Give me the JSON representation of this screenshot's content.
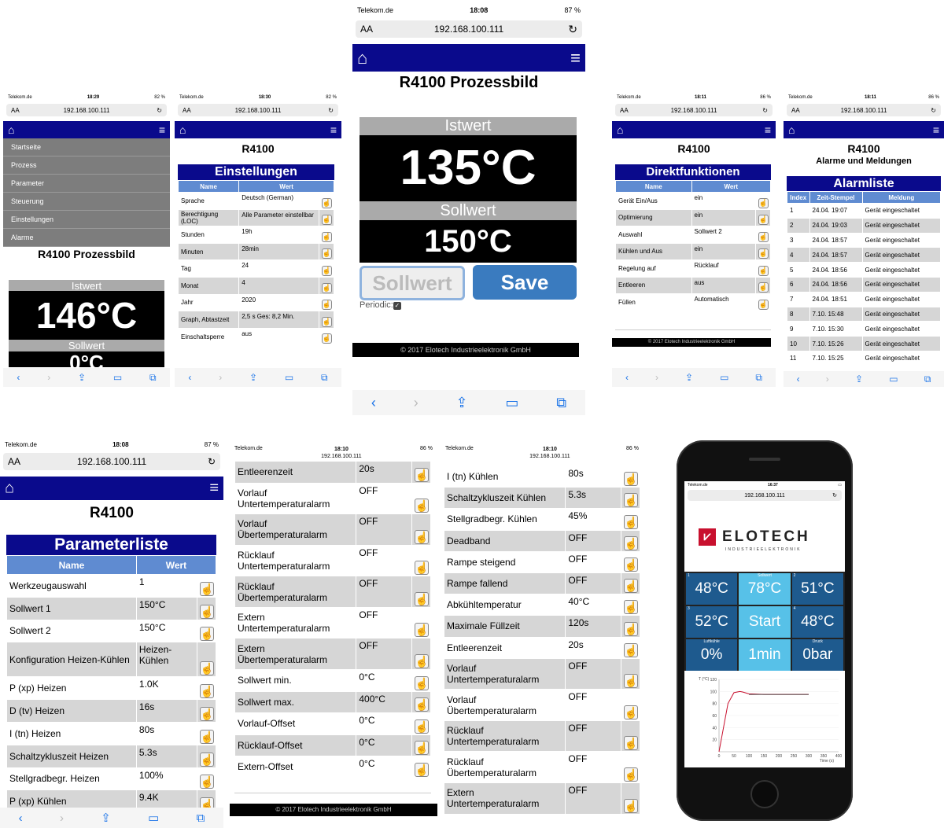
{
  "status": {
    "carrier": "Telekom.de",
    "url": "192.168.100.111",
    "aa": "AA"
  },
  "p1": {
    "time": "18:29",
    "batt": "82 %",
    "menu": [
      "Startseite",
      "Prozess",
      "Parameter",
      "Steuerung",
      "Einstellungen",
      "Alarme"
    ],
    "title": "R4100 Prozessbild",
    "ist_label": "Istwert",
    "ist": "146°C",
    "soll_label": "Sollwert",
    "soll_partial": "0°C"
  },
  "p2": {
    "time": "18:30",
    "batt": "82 %",
    "title": "R4100",
    "section": "Einstellungen",
    "col_name": "Name",
    "col_val": "Wert",
    "rows": [
      [
        "Sprache",
        "Deutsch (German)"
      ],
      [
        "Berechtigung (LOC)",
        "Alle Parameter einstellbar"
      ],
      [
        "Stunden",
        "19h"
      ],
      [
        "Minuten",
        "28min"
      ],
      [
        "Tag",
        "24"
      ],
      [
        "Monat",
        "4"
      ],
      [
        "Jahr",
        "2020"
      ],
      [
        "Graph, Abtastzeit",
        "2,5 s Ges: 8,2 Min."
      ],
      [
        "Einschaltsperre",
        "aus"
      ]
    ]
  },
  "p3": {
    "time": "18:08",
    "batt": "87 %",
    "title": "R4100 Prozessbild",
    "ist_label": "Istwert",
    "ist": "135°C",
    "soll_label": "Sollwert",
    "soll": "150°C",
    "btn_sollwert": "Sollwert",
    "btn_save": "Save",
    "periodic": "Periodic:",
    "footer": "© 2017 Elotech Industrieelektronik GmbH"
  },
  "p4": {
    "time": "18:11",
    "batt": "86 %",
    "title": "R4100",
    "section": "Direktfunktionen",
    "col_name": "Name",
    "col_val": "Wert",
    "rows": [
      [
        "Gerät Ein/Aus",
        "ein"
      ],
      [
        "Optimierung",
        "ein"
      ],
      [
        "Auswahl",
        "Sollwert 2"
      ],
      [
        "Kühlen und Aus",
        "ein"
      ],
      [
        "Regelung auf",
        "Rücklauf"
      ],
      [
        "Entleeren",
        "aus"
      ],
      [
        "Füllen",
        "Automatisch"
      ]
    ],
    "footer": "© 2017 Elotech Industrieelektronik GmbH"
  },
  "p5": {
    "time": "18:11",
    "batt": "86 %",
    "title": "R4100",
    "subtitle": "Alarme und Meldungen",
    "section": "Alarmliste",
    "cols": [
      "Index",
      "Zeit-Stempel",
      "Meldung"
    ],
    "rows": [
      [
        "1",
        "24.04. 19:07",
        "Gerät eingeschaltet"
      ],
      [
        "2",
        "24.04. 19:03",
        "Gerät eingeschaltet"
      ],
      [
        "3",
        "24.04. 18:57",
        "Gerät eingeschaltet"
      ],
      [
        "4",
        "24.04. 18:57",
        "Gerät eingeschaltet"
      ],
      [
        "5",
        "24.04. 18:56",
        "Gerät eingeschaltet"
      ],
      [
        "6",
        "24.04. 18:56",
        "Gerät eingeschaltet"
      ],
      [
        "7",
        "24.04. 18:51",
        "Gerät eingeschaltet"
      ],
      [
        "8",
        "7.10. 15:48",
        "Gerät eingeschaltet"
      ],
      [
        "9",
        "7.10. 15:30",
        "Gerät eingeschaltet"
      ],
      [
        "10",
        "7.10. 15:26",
        "Gerät eingeschaltet"
      ],
      [
        "11",
        "7.10. 15:25",
        "Gerät eingeschaltet"
      ]
    ]
  },
  "p6": {
    "time": "18:08",
    "batt": "87 %",
    "title": "R4100",
    "section": "Parameterliste",
    "col_name": "Name",
    "col_val": "Wert",
    "rows": [
      [
        "Werkzeugauswahl",
        "1"
      ],
      [
        "Sollwert 1",
        "150°C"
      ],
      [
        "Sollwert 2",
        "150°C"
      ],
      [
        "Konfiguration Heizen-Kühlen",
        "Heizen-Kühlen"
      ],
      [
        "P (xp) Heizen",
        "1.0K"
      ],
      [
        "D (tv) Heizen",
        "16s"
      ],
      [
        "I (tn) Heizen",
        "80s"
      ],
      [
        "Schaltzykluszeit Heizen",
        "5.3s"
      ],
      [
        "Stellgradbegr. Heizen",
        "100%"
      ],
      [
        "P (xp) Kühlen",
        "9.4K"
      ]
    ]
  },
  "p7": {
    "time": "18:10",
    "batt": "86 %",
    "rows": [
      [
        "Entleerenzeit",
        "20s"
      ],
      [
        "Vorlauf Untertemperaturalarm",
        "OFF"
      ],
      [
        "Vorlauf Übertemperaturalarm",
        "OFF"
      ],
      [
        "Rücklauf Untertemperaturalarm",
        "OFF"
      ],
      [
        "Rücklauf Übertemperaturalarm",
        "OFF"
      ],
      [
        "Extern Untertemperaturalarm",
        "OFF"
      ],
      [
        "Extern Übertemperaturalarm",
        "OFF"
      ],
      [
        "Sollwert min.",
        "0°C"
      ],
      [
        "Sollwert max.",
        "400°C"
      ],
      [
        "Vorlauf-Offset",
        "0°C"
      ],
      [
        "Rücklauf-Offset",
        "0°C"
      ],
      [
        "Extern-Offset",
        "0°C"
      ]
    ],
    "footer": "© 2017 Elotech Industrieelektronik GmbH"
  },
  "p8": {
    "time": "18:10",
    "batt": "86 %",
    "rows": [
      [
        "I (tn) Kühlen",
        "80s"
      ],
      [
        "Schaltzykluszeit Kühlen",
        "5.3s"
      ],
      [
        "Stellgradbegr. Kühlen",
        "45%"
      ],
      [
        "Deadband",
        "OFF"
      ],
      [
        "Rampe steigend",
        "OFF"
      ],
      [
        "Rampe fallend",
        "OFF"
      ],
      [
        "Abkühltemperatur",
        "40°C"
      ],
      [
        "Maximale Füllzeit",
        "120s"
      ],
      [
        "Entleerenzeit",
        "20s"
      ],
      [
        "Vorlauf Untertemperaturalarm",
        "OFF"
      ],
      [
        "Vorlauf Übertemperaturalarm",
        "OFF"
      ],
      [
        "Rücklauf Untertemperaturalarm",
        "OFF"
      ],
      [
        "Rücklauf Übertemperaturalarm",
        "OFF"
      ],
      [
        "Extern Untertemperaturalarm",
        "OFF"
      ]
    ]
  },
  "p9": {
    "time": "16:37",
    "brand": "ELOTECH",
    "brand_sub": "INDUSTRIEELEKTRONIK",
    "tiles": [
      {
        "n": "1",
        "lbl": "",
        "v": "48°C",
        "c": "#1e5a8e"
      },
      {
        "n": "",
        "lbl": "Sollwert",
        "v": "78°C",
        "c": "#57c1e8"
      },
      {
        "n": "2",
        "lbl": "",
        "v": "51°C",
        "c": "#1e5a8e"
      },
      {
        "n": "3",
        "lbl": "",
        "v": "52°C",
        "c": "#1e5a8e"
      },
      {
        "n": "",
        "lbl": "",
        "v": "Start",
        "c": "#57c1e8"
      },
      {
        "n": "4",
        "lbl": "",
        "v": "48°C",
        "c": "#1e5a8e"
      },
      {
        "n": "",
        "lbl": "Luftkühle",
        "v": "0%",
        "c": "#1e5a8e"
      },
      {
        "n": "",
        "lbl": "",
        "v": "1min",
        "c": "#57c1e8"
      },
      {
        "n": "",
        "lbl": "Druck",
        "v": "0bar",
        "c": "#1e5a8e"
      }
    ],
    "chart_data": {
      "type": "line",
      "ylabel": "T (°C)",
      "xlabel": "Time (s)",
      "ylim": [
        0,
        120
      ],
      "xlim": [
        0,
        400
      ],
      "yticks": [
        20,
        40,
        60,
        80,
        100,
        120
      ],
      "xticks": [
        0,
        50,
        100,
        150,
        200,
        250,
        300,
        350,
        400
      ],
      "series": [
        {
          "x": [
            0,
            15,
            30,
            50,
            70,
            80,
            100,
            150,
            200,
            250,
            300
          ],
          "y": [
            0,
            40,
            80,
            98,
            100,
            99,
            96,
            95,
            95,
            95,
            95
          ]
        }
      ],
      "setpoint": {
        "x": [
          100,
          300
        ],
        "y": [
          95,
          95
        ]
      }
    }
  }
}
